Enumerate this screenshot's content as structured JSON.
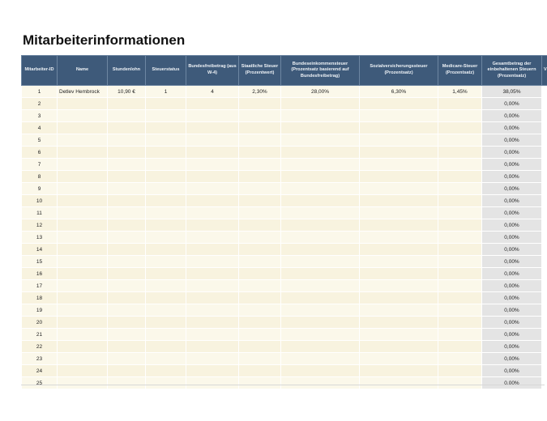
{
  "page": {
    "title": "Mitarbeiterinformationen"
  },
  "table": {
    "headers": [
      "Mitarbeiter-ID",
      "Name",
      "Stundenlohn",
      "Steuerstatus",
      "Bundesfreibetrag (aus W-4)",
      "Staatliche Steuer (Prozentwert)",
      "Bundeseinkommensteuer (Prozentsatz basierend auf Bundesfreibetrag)",
      "Sozialversicherungssteuer (Prozentsatz)",
      "Medicare-Steuer (Prozentsatz)",
      "Gesamtbetrag der einbehaltenen Steuern (Prozentsatz)",
      "V"
    ],
    "rows": [
      [
        "1",
        "Detlev Hembrock",
        "10,90 €",
        "1",
        "4",
        "2,30%",
        "28,00%",
        "6,30%",
        "1,45%",
        "38,05%",
        ""
      ],
      [
        "2",
        "",
        "",
        "",
        "",
        "",
        "",
        "",
        "",
        "0,00%",
        ""
      ],
      [
        "3",
        "",
        "",
        "",
        "",
        "",
        "",
        "",
        "",
        "0,00%",
        ""
      ],
      [
        "4",
        "",
        "",
        "",
        "",
        "",
        "",
        "",
        "",
        "0,00%",
        ""
      ],
      [
        "5",
        "",
        "",
        "",
        "",
        "",
        "",
        "",
        "",
        "0,00%",
        ""
      ],
      [
        "6",
        "",
        "",
        "",
        "",
        "",
        "",
        "",
        "",
        "0,00%",
        ""
      ],
      [
        "7",
        "",
        "",
        "",
        "",
        "",
        "",
        "",
        "",
        "0,00%",
        ""
      ],
      [
        "8",
        "",
        "",
        "",
        "",
        "",
        "",
        "",
        "",
        "0,00%",
        ""
      ],
      [
        "9",
        "",
        "",
        "",
        "",
        "",
        "",
        "",
        "",
        "0,00%",
        ""
      ],
      [
        "10",
        "",
        "",
        "",
        "",
        "",
        "",
        "",
        "",
        "0,00%",
        ""
      ],
      [
        "11",
        "",
        "",
        "",
        "",
        "",
        "",
        "",
        "",
        "0,00%",
        ""
      ],
      [
        "12",
        "",
        "",
        "",
        "",
        "",
        "",
        "",
        "",
        "0,00%",
        ""
      ],
      [
        "13",
        "",
        "",
        "",
        "",
        "",
        "",
        "",
        "",
        "0,00%",
        ""
      ],
      [
        "14",
        "",
        "",
        "",
        "",
        "",
        "",
        "",
        "",
        "0,00%",
        ""
      ],
      [
        "15",
        "",
        "",
        "",
        "",
        "",
        "",
        "",
        "",
        "0,00%",
        ""
      ],
      [
        "16",
        "",
        "",
        "",
        "",
        "",
        "",
        "",
        "",
        "0,00%",
        ""
      ],
      [
        "17",
        "",
        "",
        "",
        "",
        "",
        "",
        "",
        "",
        "0,00%",
        ""
      ],
      [
        "18",
        "",
        "",
        "",
        "",
        "",
        "",
        "",
        "",
        "0,00%",
        ""
      ],
      [
        "19",
        "",
        "",
        "",
        "",
        "",
        "",
        "",
        "",
        "0,00%",
        ""
      ],
      [
        "20",
        "",
        "",
        "",
        "",
        "",
        "",
        "",
        "",
        "0,00%",
        ""
      ],
      [
        "21",
        "",
        "",
        "",
        "",
        "",
        "",
        "",
        "",
        "0,00%",
        ""
      ],
      [
        "22",
        "",
        "",
        "",
        "",
        "",
        "",
        "",
        "",
        "0,00%",
        ""
      ],
      [
        "23",
        "",
        "",
        "",
        "",
        "",
        "",
        "",
        "",
        "0,00%",
        ""
      ],
      [
        "24",
        "",
        "",
        "",
        "",
        "",
        "",
        "",
        "",
        "0,00%",
        ""
      ],
      [
        "25",
        "",
        "",
        "",
        "",
        "",
        "",
        "",
        "",
        "0,00%",
        ""
      ]
    ]
  },
  "colors": {
    "header_bg": "#3e5a7a",
    "row_bg": "#fbf8ea",
    "total_column_bg": "#e4e4e4"
  }
}
